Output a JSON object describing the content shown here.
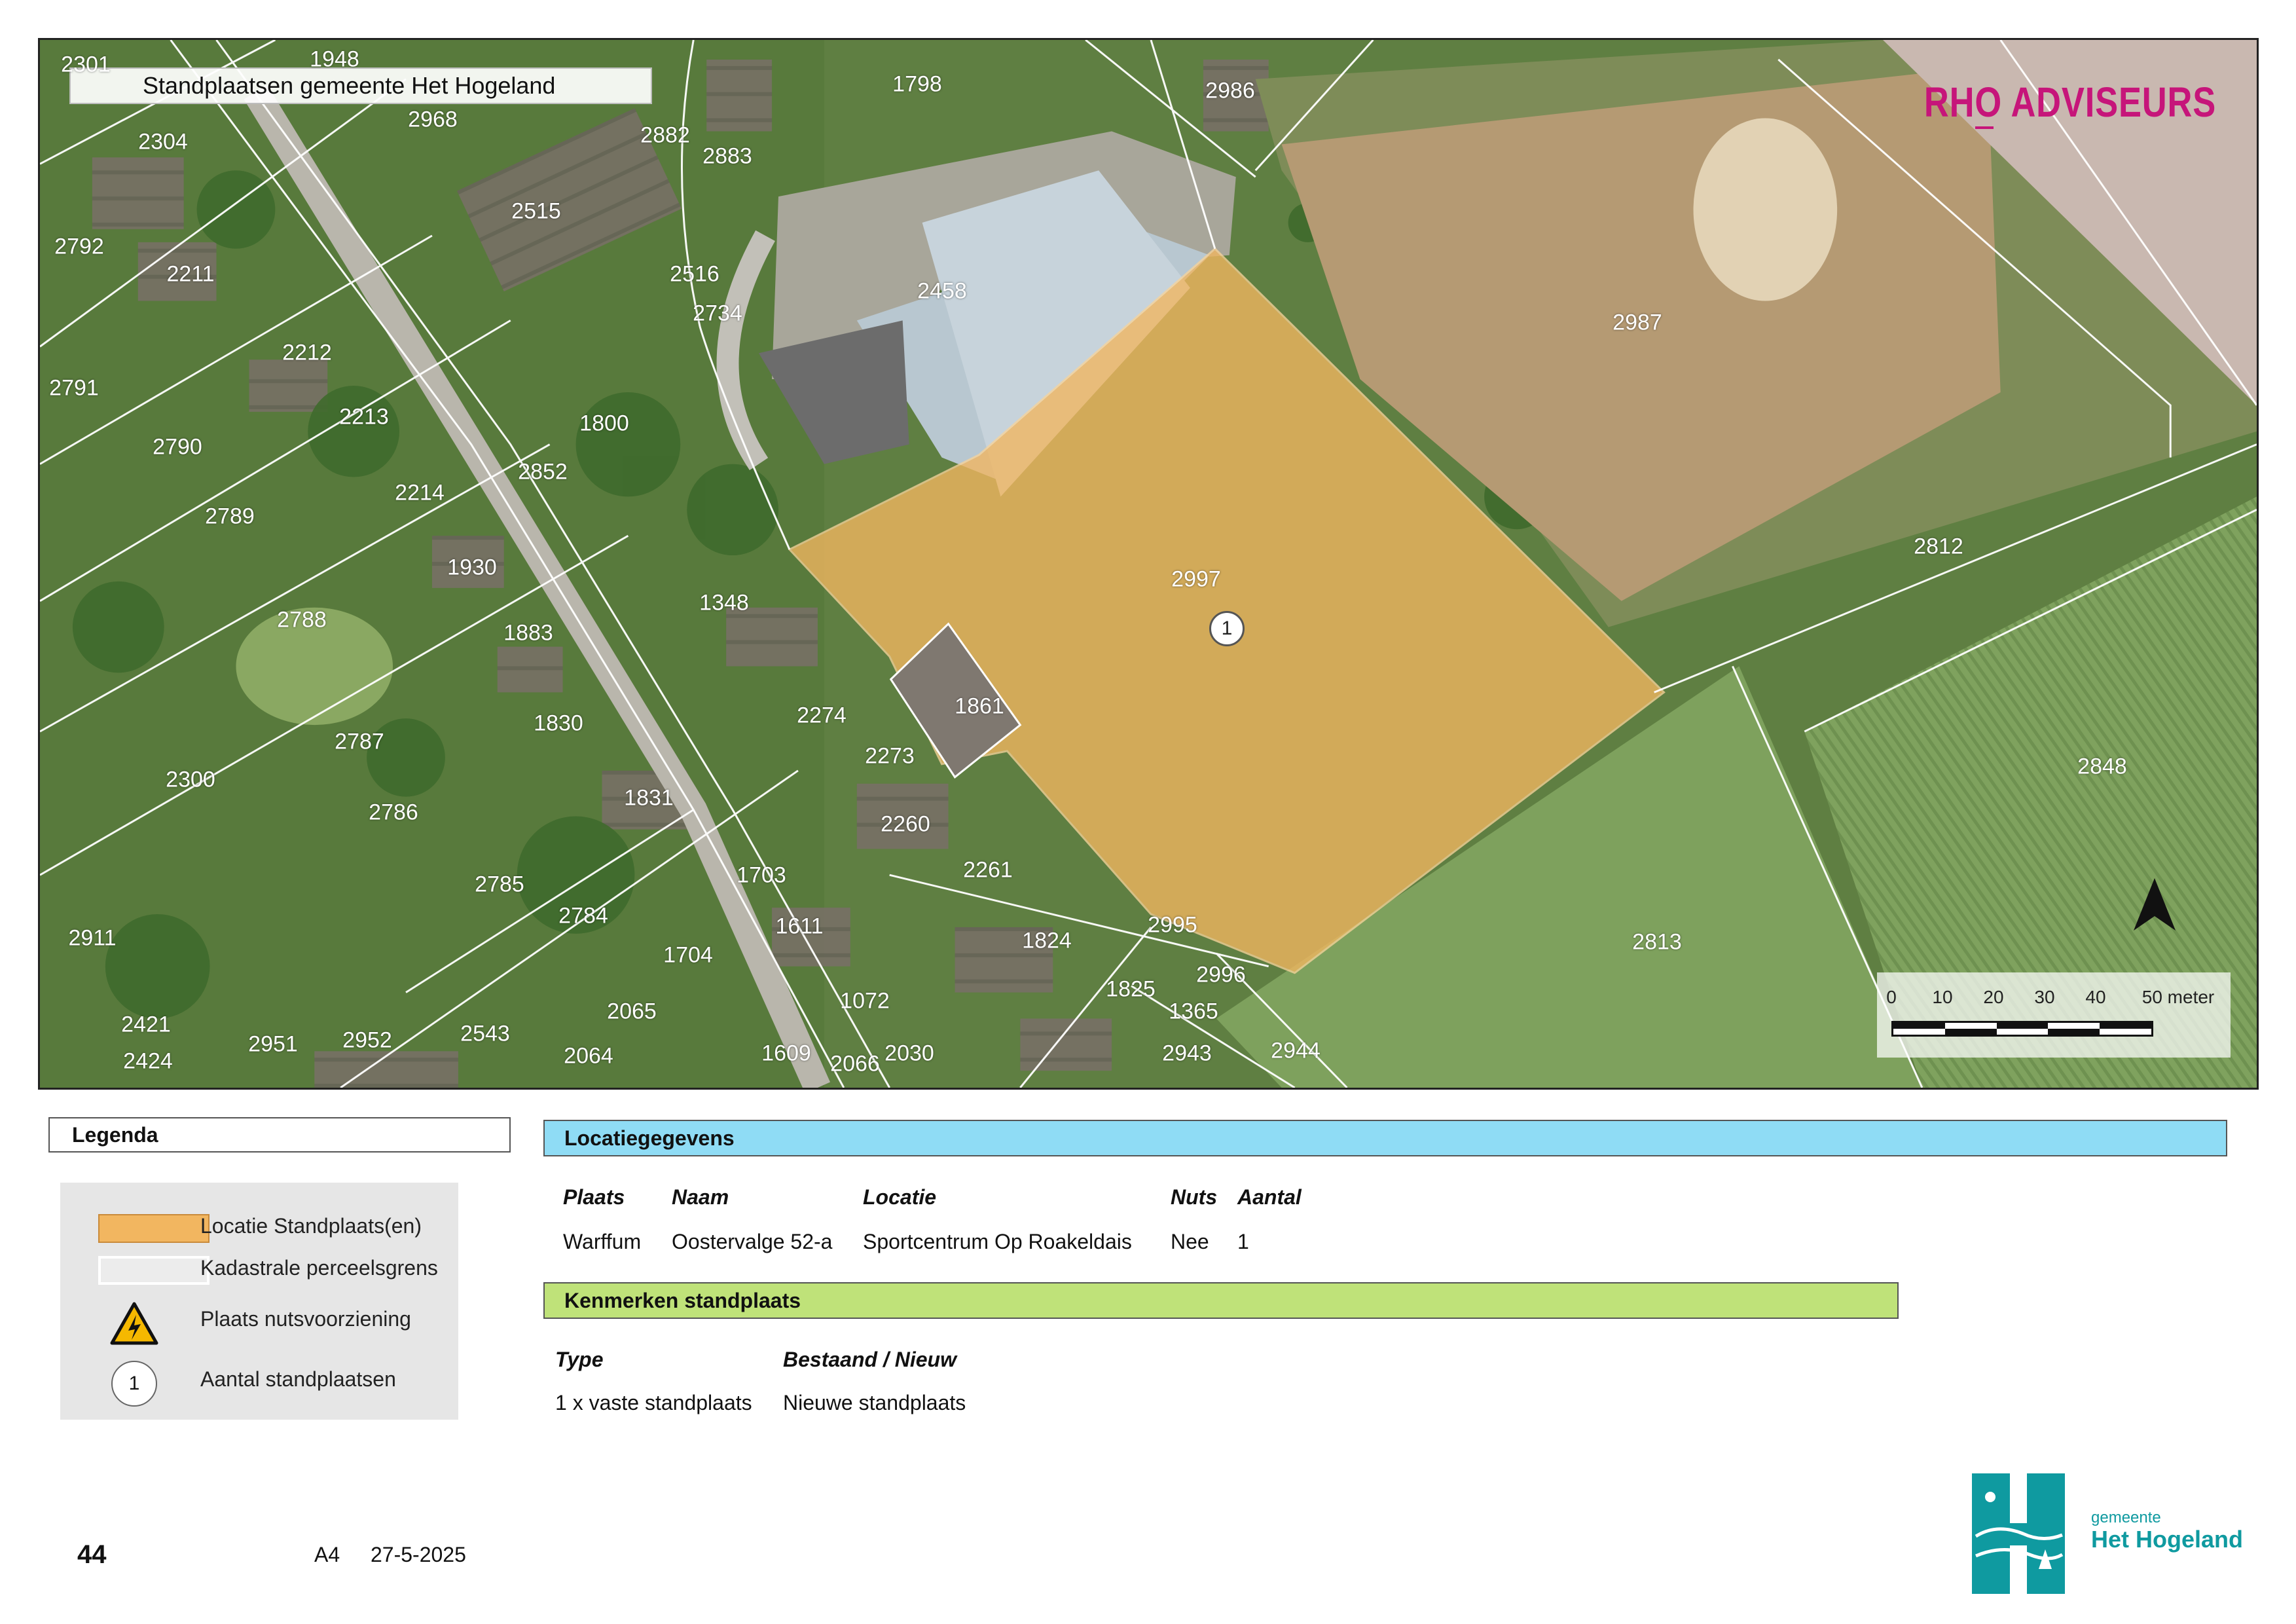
{
  "map": {
    "title": "Standplaatsen gemeente Het Hogeland",
    "brand": "RHO ADVISEURS",
    "brand_color": "#c6157a",
    "location_fill": "#f2b660",
    "marker_label": "1",
    "parcels": [
      "2301",
      "1948",
      "2968",
      "2304",
      "2882",
      "2883",
      "2515",
      "1798",
      "2986",
      "2792",
      "2211",
      "2516",
      "2734",
      "2458",
      "2987",
      "2212",
      "2791",
      "2213",
      "2790",
      "1800",
      "2852",
      "2214",
      "2789",
      "1930",
      "1348",
      "2997",
      "2788",
      "1883",
      "2812",
      "1861",
      "2274",
      "1830",
      "2273",
      "2787",
      "2300",
      "2848",
      "1831",
      "2786",
      "2260",
      "2261",
      "1703",
      "2785",
      "2784",
      "1611",
      "1824",
      "2995",
      "2813",
      "2911",
      "1704",
      "2996",
      "1825",
      "1072",
      "1365",
      "2065",
      "2421",
      "2951",
      "2952",
      "2543",
      "2424",
      "2064",
      "1609",
      "2066",
      "2030",
      "2943",
      "2944"
    ],
    "scale": {
      "ticks": [
        "0",
        "10",
        "20",
        "30",
        "40",
        "50 meter"
      ]
    },
    "north_icon": "north-arrow-icon"
  },
  "legend": {
    "title": "Legenda",
    "items": [
      {
        "label": "Locatie Standplaats(en)",
        "icon": "location-swatch"
      },
      {
        "label": "Kadastrale perceelsgrens",
        "icon": "parcel-border-swatch"
      },
      {
        "label": "Plaats nutsvoorziening",
        "icon": "high-voltage-warning-icon"
      },
      {
        "label": "Aantal standplaatsen",
        "icon": "count-circle-icon",
        "symbol": "1"
      }
    ]
  },
  "locatiegegevens": {
    "title": "Locatiegegevens",
    "headers": [
      "Plaats",
      "Naam",
      "Locatie",
      "Nuts",
      "Aantal"
    ],
    "row": [
      "Warffum",
      "Oostervalge 52-a",
      "Sportcentrum Op Roakeldais",
      "Nee",
      "1"
    ]
  },
  "kenmerken": {
    "title": "Kenmerken standplaats",
    "headers": [
      "Type",
      "Bestaand / Nieuw"
    ],
    "row": [
      "1 x vaste standplaats",
      "Nieuwe standplaats"
    ]
  },
  "footer": {
    "page_number": "44",
    "paper_size": "A4",
    "date": "27-5-2025",
    "logo_small": "gemeente",
    "logo_big": "Het Hogeland"
  },
  "colors": {
    "band_blue": "#8fdcf5",
    "band_green": "#bfe279",
    "logo_teal": "#0f9aa0"
  }
}
